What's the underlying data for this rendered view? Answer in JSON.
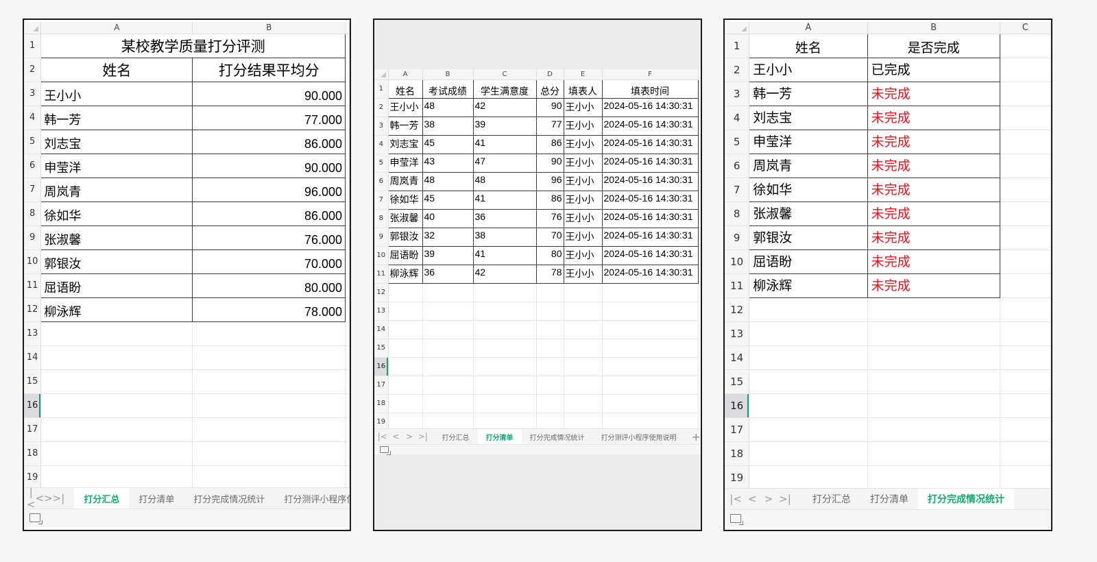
{
  "summary": {
    "columns": [
      "A",
      "B"
    ],
    "title": "某校教学质量打分评测",
    "headers": [
      "姓名",
      "打分结果平均分"
    ],
    "rows": [
      {
        "name": "王小小",
        "avg": "90.000"
      },
      {
        "name": "韩一芳",
        "avg": "77.000"
      },
      {
        "name": "刘志宝",
        "avg": "86.000"
      },
      {
        "name": "申莹洋",
        "avg": "90.000"
      },
      {
        "name": "周岚青",
        "avg": "96.000"
      },
      {
        "name": "徐如华",
        "avg": "86.000"
      },
      {
        "name": "张淑馨",
        "avg": "76.000"
      },
      {
        "name": "郭银汝",
        "avg": "70.000"
      },
      {
        "name": "屈语盼",
        "avg": "80.000"
      },
      {
        "name": "柳泳辉",
        "avg": "78.000"
      }
    ],
    "row_numbers": [
      "1",
      "2",
      "3",
      "4",
      "5",
      "6",
      "7",
      "8",
      "9",
      "10",
      "11",
      "12",
      "13",
      "14",
      "15",
      "16",
      "17",
      "18",
      "19"
    ],
    "tabs": [
      "打分汇总",
      "打分清单",
      "打分完成情况统计",
      "打分测评小程序使用"
    ],
    "active_tab": "打分汇总"
  },
  "scores": {
    "columns": [
      "A",
      "B",
      "C",
      "D",
      "E",
      "F"
    ],
    "headers": [
      "姓名",
      "考试成绩",
      "学生满意度",
      "总分",
      "填表人",
      "填表时间"
    ],
    "rows": [
      {
        "name": "王小小",
        "exam": "48",
        "satisfaction": "42",
        "total": "90",
        "filler": "王小小",
        "time": "2024-05-16 14:30:31"
      },
      {
        "name": "韩一芳",
        "exam": "38",
        "satisfaction": "39",
        "total": "77",
        "filler": "王小小",
        "time": "2024-05-16 14:30:31"
      },
      {
        "name": "刘志宝",
        "exam": "45",
        "satisfaction": "41",
        "total": "86",
        "filler": "王小小",
        "time": "2024-05-16 14:30:31"
      },
      {
        "name": "申莹洋",
        "exam": "43",
        "satisfaction": "47",
        "total": "90",
        "filler": "王小小",
        "time": "2024-05-16 14:30:31"
      },
      {
        "name": "周岚青",
        "exam": "48",
        "satisfaction": "48",
        "total": "96",
        "filler": "王小小",
        "time": "2024-05-16 14:30:31"
      },
      {
        "name": "徐如华",
        "exam": "45",
        "satisfaction": "41",
        "total": "86",
        "filler": "王小小",
        "time": "2024-05-16 14:30:31"
      },
      {
        "name": "张淑馨",
        "exam": "40",
        "satisfaction": "36",
        "total": "76",
        "filler": "王小小",
        "time": "2024-05-16 14:30:31"
      },
      {
        "name": "郭银汝",
        "exam": "32",
        "satisfaction": "38",
        "total": "70",
        "filler": "王小小",
        "time": "2024-05-16 14:30:31"
      },
      {
        "name": "屈语盼",
        "exam": "39",
        "satisfaction": "41",
        "total": "80",
        "filler": "王小小",
        "time": "2024-05-16 14:30:31"
      },
      {
        "name": "柳泳辉",
        "exam": "36",
        "satisfaction": "42",
        "total": "78",
        "filler": "王小小",
        "time": "2024-05-16 14:30:31"
      }
    ],
    "row_numbers": [
      "1",
      "2",
      "3",
      "4",
      "5",
      "6",
      "7",
      "8",
      "9",
      "10",
      "11",
      "12",
      "13",
      "14",
      "15",
      "16",
      "17",
      "18",
      "19"
    ],
    "tabs": [
      "打分汇总",
      "打分清单",
      "打分完成情况统计",
      "打分测评小程序使用说明"
    ],
    "active_tab": "打分清单"
  },
  "completion": {
    "columns": [
      "A",
      "B",
      "C"
    ],
    "headers": [
      "姓名",
      "是否完成"
    ],
    "rows": [
      {
        "name": "王小小",
        "status": "已完成",
        "done": true
      },
      {
        "name": "韩一芳",
        "status": "未完成",
        "done": false
      },
      {
        "name": "刘志宝",
        "status": "未完成",
        "done": false
      },
      {
        "name": "申莹洋",
        "status": "未完成",
        "done": false
      },
      {
        "name": "周岚青",
        "status": "未完成",
        "done": false
      },
      {
        "name": "徐如华",
        "status": "未完成",
        "done": false
      },
      {
        "name": "张淑馨",
        "status": "未完成",
        "done": false
      },
      {
        "name": "郭银汝",
        "status": "未完成",
        "done": false
      },
      {
        "name": "屈语盼",
        "status": "未完成",
        "done": false
      },
      {
        "name": "柳泳辉",
        "status": "未完成",
        "done": false
      }
    ],
    "row_numbers": [
      "1",
      "2",
      "3",
      "4",
      "5",
      "6",
      "7",
      "8",
      "9",
      "10",
      "11",
      "12",
      "13",
      "14",
      "15",
      "16",
      "17",
      "18",
      "19"
    ],
    "tabs": [
      "打分汇总",
      "打分清单",
      "打分完成情况统计"
    ],
    "active_tab": "打分完成情况统计"
  },
  "selected_row": "16",
  "nav_icons": [
    "first-sheet-icon",
    "prev-sheet-icon",
    "next-sheet-icon",
    "last-sheet-icon"
  ],
  "colors": {
    "accent": "#14a86e",
    "incomplete": "#e0141e",
    "border": "#1a1a1a"
  }
}
